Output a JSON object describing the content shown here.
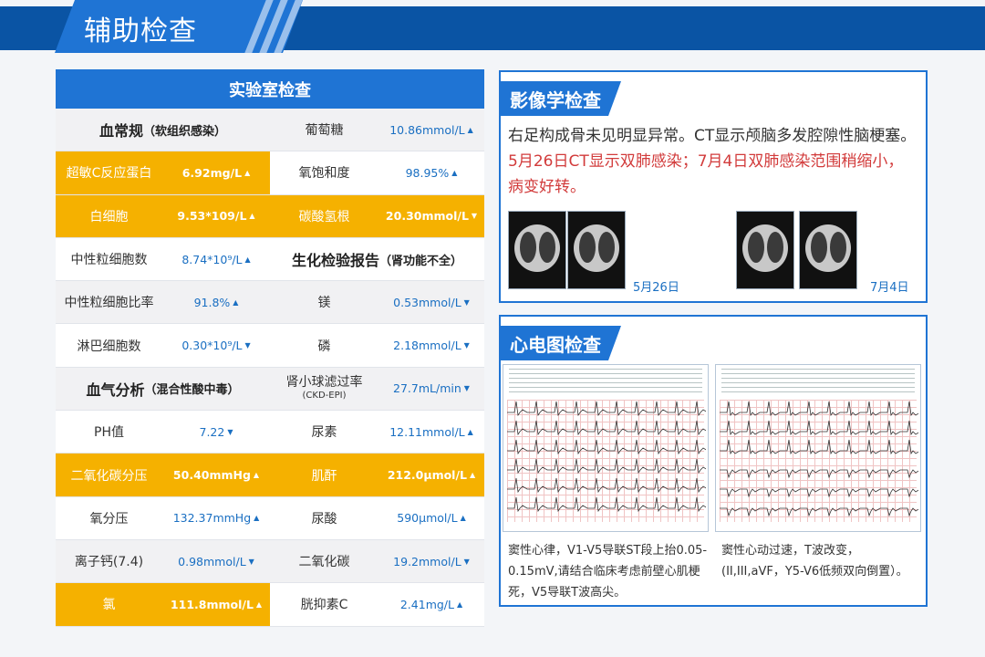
{
  "header": {
    "title": "辅助检查"
  },
  "lab": {
    "title": "实验室检查",
    "rows": [
      {
        "bg": "gray",
        "cells": [
          {
            "type": "section",
            "text": "血常规",
            "sub": "（软组织感染）",
            "span": 2
          },
          {
            "type": "label",
            "text": "葡萄糖"
          },
          {
            "type": "value",
            "text": "10.86mmol/L",
            "arrow": "▲"
          }
        ]
      },
      {
        "bg": "white",
        "cells": [
          {
            "type": "label",
            "text": "超敏C反应蛋白",
            "hl": true
          },
          {
            "type": "value",
            "text": "6.92mg/L",
            "arrow": "▲",
            "hl": true
          },
          {
            "type": "label",
            "text": "氧饱和度"
          },
          {
            "type": "value",
            "text": "98.95%",
            "arrow": "▲"
          }
        ]
      },
      {
        "bg": "gray",
        "cells": [
          {
            "type": "label",
            "text": "白细胞",
            "hl": true
          },
          {
            "type": "value",
            "text": "9.53*109/L",
            "arrow": "▲",
            "hl": true
          },
          {
            "type": "label",
            "text": "碳酸氢根",
            "hl": true
          },
          {
            "type": "value",
            "text": "20.30mmol/L",
            "arrow": "▼",
            "hl": true
          }
        ]
      },
      {
        "bg": "white",
        "cells": [
          {
            "type": "label",
            "text": "中性粒细胞数"
          },
          {
            "type": "value",
            "text": "8.74*10⁹/L",
            "arrow": "▲"
          },
          {
            "type": "section",
            "text": "生化检验报告",
            "sub": "（肾功能不全）",
            "span": 2
          }
        ]
      },
      {
        "bg": "gray",
        "cells": [
          {
            "type": "label",
            "text": "中性粒细胞比率"
          },
          {
            "type": "value",
            "text": "91.8%",
            "arrow": "▲"
          },
          {
            "type": "label",
            "text": "镁"
          },
          {
            "type": "value",
            "text": "0.53mmol/L",
            "arrow": "▼"
          }
        ]
      },
      {
        "bg": "white",
        "cells": [
          {
            "type": "label",
            "text": "淋巴细胞数"
          },
          {
            "type": "value",
            "text": "0.30*10⁹/L",
            "arrow": "▼"
          },
          {
            "type": "label",
            "text": "磷"
          },
          {
            "type": "value",
            "text": "2.18mmol/L",
            "arrow": "▼"
          }
        ]
      },
      {
        "bg": "gray",
        "cells": [
          {
            "type": "section",
            "text": "血气分析",
            "sub": "（混合性酸中毒）",
            "span": 2
          },
          {
            "type": "label2",
            "text": "肾小球滤过率",
            "sub": "(CKD-EPI)"
          },
          {
            "type": "value",
            "text": "27.7mL/min",
            "arrow": "▼"
          }
        ]
      },
      {
        "bg": "white",
        "cells": [
          {
            "type": "label",
            "text": "PH值"
          },
          {
            "type": "value",
            "text": "7.22",
            "arrow": "▼"
          },
          {
            "type": "label",
            "text": "尿素"
          },
          {
            "type": "value",
            "text": "12.11mmol/L",
            "arrow": "▲"
          }
        ]
      },
      {
        "bg": "gray",
        "cells": [
          {
            "type": "label",
            "text": "二氧化碳分压",
            "hl": true
          },
          {
            "type": "value",
            "text": "50.40mmHg",
            "arrow": "▲",
            "hl": true
          },
          {
            "type": "label",
            "text": "肌酐",
            "hl": true
          },
          {
            "type": "value",
            "text": "212.0μmol/L",
            "arrow": "▲",
            "hl": true
          }
        ]
      },
      {
        "bg": "white",
        "cells": [
          {
            "type": "label",
            "text": "氧分压"
          },
          {
            "type": "value",
            "text": "132.37mmHg",
            "arrow": "▲"
          },
          {
            "type": "label",
            "text": "尿酸"
          },
          {
            "type": "value",
            "text": "590μmol/L",
            "arrow": "▲"
          }
        ]
      },
      {
        "bg": "gray",
        "cells": [
          {
            "type": "label",
            "text": "离子钙(7.4)"
          },
          {
            "type": "value",
            "text": "0.98mmol/L",
            "arrow": "▼"
          },
          {
            "type": "label",
            "text": "二氧化碳"
          },
          {
            "type": "value",
            "text": "19.2mmol/L",
            "arrow": "▼"
          }
        ]
      },
      {
        "bg": "white",
        "cells": [
          {
            "type": "label",
            "text": "氯",
            "hl": true
          },
          {
            "type": "value",
            "text": "111.8mmol/L",
            "arrow": "▲",
            "hl": true
          },
          {
            "type": "label",
            "text": "胱抑素C"
          },
          {
            "type": "value",
            "text": "2.41mg/L",
            "arrow": "▲"
          }
        ]
      }
    ]
  },
  "imaging": {
    "title": "影像学检查",
    "line1": "右足构成骨未见明显异常。CT显示颅脑多发腔隙性脑梗塞。",
    "line2": "5月26日CT显示双肺感染；7月4日双肺感染范围稍缩小，",
    "line3": "病变好转。",
    "caption_1": "5月26日",
    "caption_2": "7月4日"
  },
  "ecg": {
    "title": "心电图检查",
    "desc_1": "窦性心律，V1-V5导联ST段上抬0.05-0.15mV,请结合临床考虑前壁心肌梗死，V5导联T波高尖。",
    "desc_2": "窦性心动过速，T波改变，(II,III,aVF，Y5-V6低频双向倒置）。"
  },
  "colors": {
    "primary": "#1f74d4",
    "dark": "#0a54a4",
    "highlight": "#f5b100",
    "alert": "#d23b3b"
  }
}
